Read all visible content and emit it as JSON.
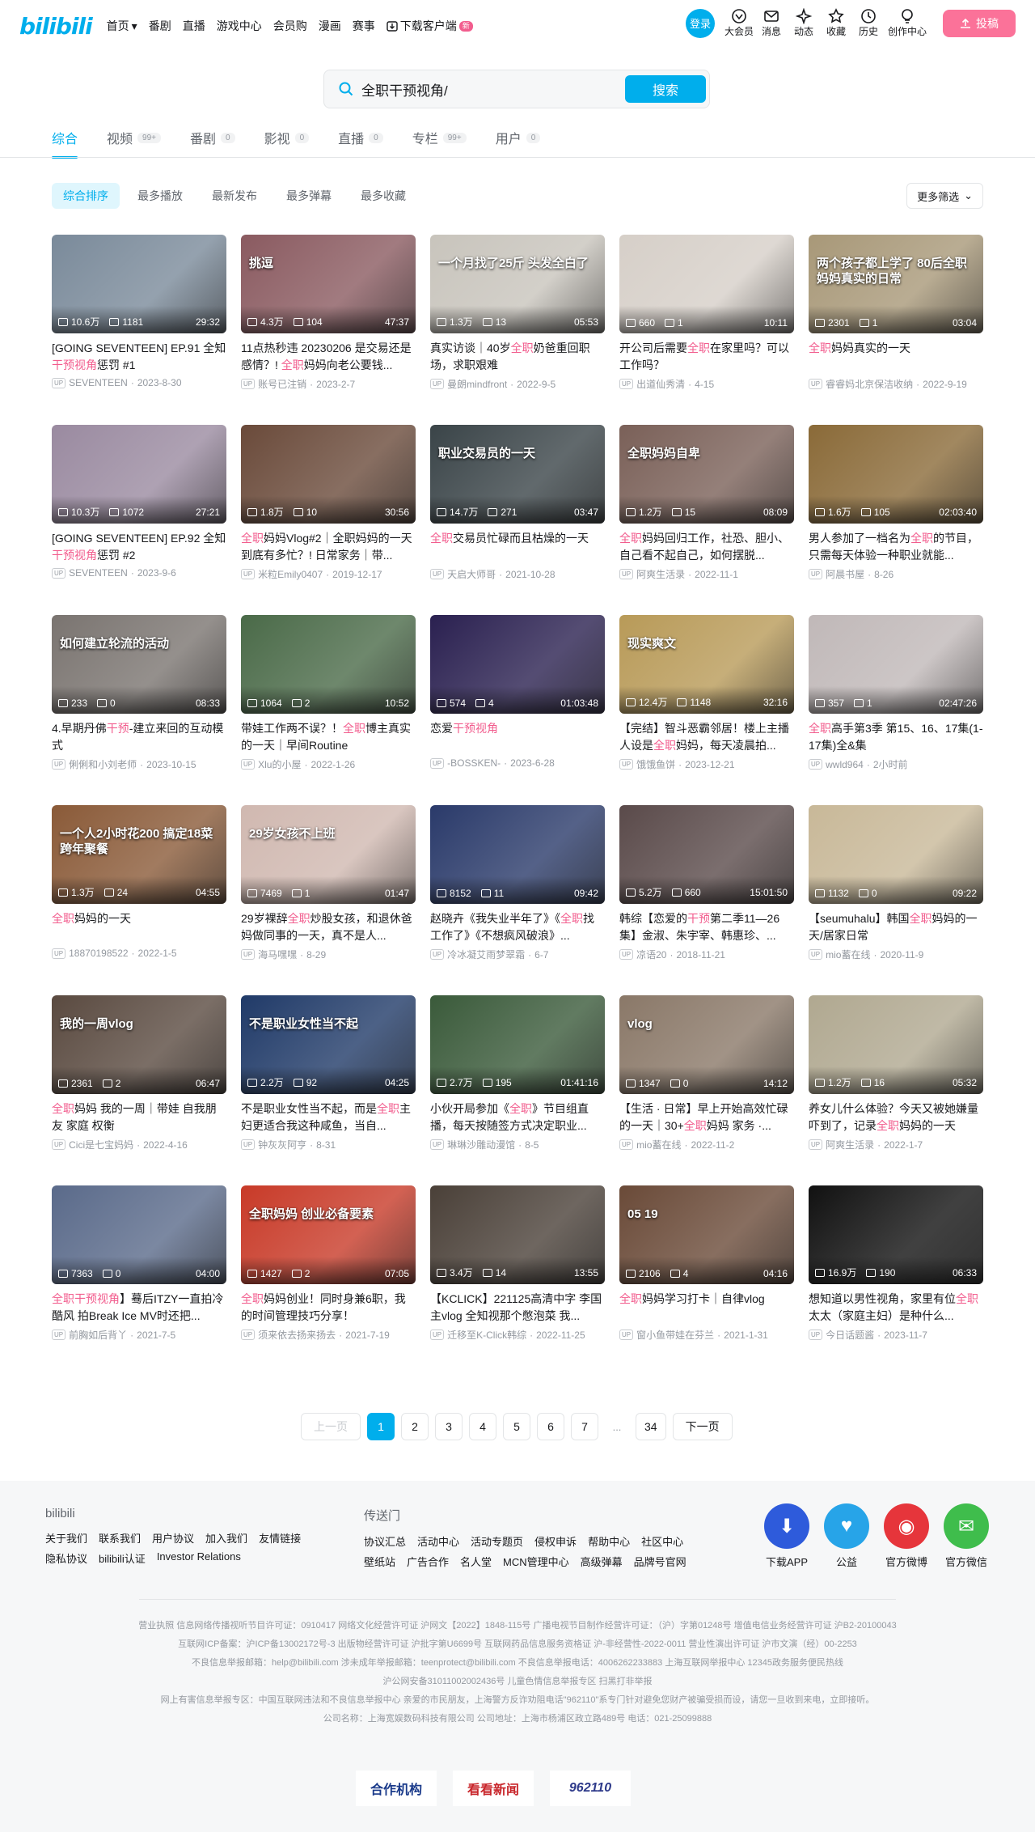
{
  "header": {
    "logo": "bilibili",
    "nav": [
      "首页",
      "番剧",
      "直播",
      "游戏中心",
      "会员购",
      "漫画",
      "赛事",
      "下载客户端"
    ],
    "download_badge": "新",
    "login": "登录",
    "icons": [
      {
        "label": "大会员",
        "icon": "vip-icon"
      },
      {
        "label": "消息",
        "icon": "message-icon"
      },
      {
        "label": "动态",
        "icon": "dynamic-icon"
      },
      {
        "label": "收藏",
        "icon": "star-icon"
      },
      {
        "label": "历史",
        "icon": "history-icon"
      },
      {
        "label": "创作中心",
        "icon": "bulb-icon"
      }
    ],
    "upload": "投稿"
  },
  "search": {
    "value": "全职干预视角/",
    "button": "搜索"
  },
  "tabs": [
    {
      "label": "综合",
      "count": ""
    },
    {
      "label": "视频",
      "count": "99+"
    },
    {
      "label": "番剧",
      "count": "0"
    },
    {
      "label": "影视",
      "count": "0"
    },
    {
      "label": "直播",
      "count": "0"
    },
    {
      "label": "专栏",
      "count": "99+"
    },
    {
      "label": "用户",
      "count": "0"
    }
  ],
  "sorts": [
    "综合排序",
    "最多播放",
    "最新发布",
    "最多弹幕",
    "最多收藏"
  ],
  "filter": "更多筛选",
  "videos": [
    {
      "title": "[GOING SEVENTEEN] EP.91 全知干预视角惩罚 #1",
      "hl": "干预视角",
      "plays": "10.6万",
      "danmaku": "1181",
      "duration": "29:32",
      "author": "SEVENTEEN",
      "date": "2023-8-30",
      "overlay": "",
      "bg": "#7a8a9a"
    },
    {
      "title": "11点热秒违 20230206 是交易还是感情？! 全职妈妈向老公要钱...",
      "hl": "全职",
      "plays": "4.3万",
      "danmaku": "104",
      "duration": "47:37",
      "author": "账号已注销",
      "date": "2023-2-7",
      "overlay": "挑逗",
      "bg": "#8a5a60"
    },
    {
      "title": "真实访谈｜40岁全职奶爸重回职场，求职艰难",
      "hl": "全职",
      "plays": "1.3万",
      "danmaku": "13",
      "duration": "05:53",
      "author": "曼朗mindfront",
      "date": "2022-9-5",
      "overlay": "一个月找了25斤 头发全白了",
      "bg": "#c8c4bc"
    },
    {
      "title": "开公司后需要全职在家里吗？可以工作吗？",
      "hl": "全职",
      "plays": "660",
      "danmaku": "1",
      "duration": "10:11",
      "author": "出道仙秀清",
      "date": "4-15",
      "overlay": "",
      "bg": "#d6cfc8"
    },
    {
      "title": "全职妈妈真实的一天",
      "hl": "全职",
      "plays": "2301",
      "danmaku": "1",
      "duration": "03:04",
      "author": "睿睿妈北京保洁收纳",
      "date": "2022-9-19",
      "overlay": "两个孩子都上学了 80后全职妈妈真实的日常",
      "bg": "#a89878"
    },
    {
      "title": "[GOING SEVENTEEN] EP.92 全知干预视角惩罚 #2",
      "hl": "干预视角",
      "plays": "10.3万",
      "danmaku": "1072",
      "duration": "27:21",
      "author": "SEVENTEEN",
      "date": "2023-9-6",
      "overlay": "",
      "bg": "#9a8aa0"
    },
    {
      "title": "全职妈妈Vlog#2｜全职妈妈的一天到底有多忙？! 日常家务｜带...",
      "hl": "全职",
      "plays": "1.8万",
      "danmaku": "10",
      "duration": "30:56",
      "author": "米粒Emily0407",
      "date": "2019-12-17",
      "overlay": "",
      "bg": "#6a4a3a"
    },
    {
      "title": "全职交易员忙碌而且枯燥的一天",
      "hl": "全职",
      "plays": "14.7万",
      "danmaku": "271",
      "duration": "03:47",
      "author": "天启大师哥",
      "date": "2021-10-28",
      "overlay": "职业交易员的一天",
      "bg": "#3a4448"
    },
    {
      "title": "全职妈妈回归工作，社恐、胆小、自己看不起自己，如何摆脱...",
      "hl": "全职",
      "plays": "1.2万",
      "danmaku": "15",
      "duration": "08:09",
      "author": "阿爽生活录",
      "date": "2022-11-1",
      "overlay": "全职妈妈自卑",
      "bg": "#7a6058"
    },
    {
      "title": "男人参加了一档名为全职的节目，只需每天体验一种职业就能...",
      "hl": "全职",
      "plays": "1.6万",
      "danmaku": "105",
      "duration": "02:03:40",
      "author": "阿晨书屋",
      "date": "8-26",
      "overlay": "",
      "bg": "#8a6a38"
    },
    {
      "title": "4.早期丹佛干预-建立来回的互动模式",
      "hl": "干预",
      "plays": "233",
      "danmaku": "0",
      "duration": "08:33",
      "author": "俐俐和小刘老师",
      "date": "2023-10-15",
      "overlay": "如何建立轮流的活动",
      "bg": "#7a7470"
    },
    {
      "title": "带娃工作两不误？！全职博主真实的一天｜早间Routine",
      "hl": "全职",
      "plays": "1064",
      "danmaku": "2",
      "duration": "10:52",
      "author": "Xlu的小屋",
      "date": "2022-1-26",
      "overlay": "",
      "bg": "#4a6a48"
    },
    {
      "title": "恋爱干预视角",
      "hl": "干预视角",
      "plays": "574",
      "danmaku": "4",
      "duration": "01:03:48",
      "author": "-BOSSKEN-",
      "date": "2023-6-28",
      "overlay": "",
      "bg": "#2a2050"
    },
    {
      "title": "【完结】智斗恶霸邻居！楼上主播人设是全职妈妈，每天凌晨拍...",
      "hl": "全职",
      "plays": "12.4万",
      "danmaku": "1148",
      "duration": "32:16",
      "author": "饿饿鱼饼",
      "date": "2023-12-21",
      "overlay": "现实爽文",
      "bg": "#b89a58"
    },
    {
      "title": "全职高手第3季 第15、16、17集(1-17集)全&集",
      "hl": "全职",
      "plays": "357",
      "danmaku": "1",
      "duration": "02:47:26",
      "author": "wwld964",
      "date": "2小时前",
      "overlay": "",
      "bg": "#c0b8b8"
    },
    {
      "title": "全职妈妈的一天",
      "hl": "全职",
      "plays": "1.3万",
      "danmaku": "24",
      "duration": "04:55",
      "author": "18870198522",
      "date": "2022-1-5",
      "overlay": "一个人2小时花200 搞定18菜跨年聚餐",
      "bg": "#8a5a38"
    },
    {
      "title": "29岁裸辞全职炒股女孩，和退休爸妈做同事的一天，真不是人...",
      "hl": "全职",
      "plays": "7469",
      "danmaku": "1",
      "duration": "01:47",
      "author": "海马嘿嘿",
      "date": "8-29",
      "overlay": "29岁女孩不上班",
      "bg": "#d0b8b0"
    },
    {
      "title": "赵晓卉《我失业半年了》《全职找工作了》《不想疯风破浪》...",
      "hl": "全职",
      "plays": "8152",
      "danmaku": "11",
      "duration": "09:42",
      "author": "冷冰凝艾雨梦翠霜",
      "date": "6-7",
      "overlay": "",
      "bg": "#2a3a6a"
    },
    {
      "title": "韩综【恋爱的干预第二季11—26集】金淑、朱宇宰、韩惠珍、...",
      "hl": "干预",
      "plays": "5.2万",
      "danmaku": "660",
      "duration": "15:01:50",
      "author": "凉语20",
      "date": "2018-11-21",
      "overlay": "",
      "bg": "#5a4a4a"
    },
    {
      "title": "【seumuhalu】韩国全职妈妈的一天/居家日常",
      "hl": "全职",
      "plays": "1132",
      "danmaku": "0",
      "duration": "09:22",
      "author": "mio蓄在线",
      "date": "2020-11-9",
      "overlay": "",
      "bg": "#c8b898"
    },
    {
      "title": "全职妈妈 我的一周｜带娃 自我朋友 家庭 权衡",
      "hl": "全职",
      "plays": "2361",
      "danmaku": "2",
      "duration": "06:47",
      "author": "Cici是七宝妈妈",
      "date": "2022-4-16",
      "overlay": "我的一周vlog",
      "bg": "#5a4a40"
    },
    {
      "title": "不是职业女性当不起，而是全职主妇更适合我这种咸鱼，当自...",
      "hl": "全职",
      "plays": "2.2万",
      "danmaku": "92",
      "duration": "04:25",
      "author": "钟灰灰阿亨",
      "date": "8-31",
      "overlay": "不是职业女性当不起",
      "bg": "#203a68"
    },
    {
      "title": "小伙开局参加《全职》节目组直播，每天按随签方式决定职业...",
      "hl": "全职",
      "plays": "2.7万",
      "danmaku": "195",
      "duration": "01:41:16",
      "author": "琳琳沙雕动漫馆",
      "date": "8-5",
      "overlay": "",
      "bg": "#3a5a3a"
    },
    {
      "title": "【生活 · 日常】早上开始高效忙碌的一天｜30+全职妈妈 家务 ·...",
      "hl": "全职",
      "plays": "1347",
      "danmaku": "0",
      "duration": "14:12",
      "author": "mio蓄在线",
      "date": "2022-11-2",
      "overlay": "vlog",
      "bg": "#8a7868"
    },
    {
      "title": "养女儿什么体验？今天又被她嫌量吓到了，记录全职妈妈的一天",
      "hl": "全职",
      "plays": "1.2万",
      "danmaku": "16",
      "duration": "05:32",
      "author": "阿爽生活录",
      "date": "2022-1-7",
      "overlay": "",
      "bg": "#b0a890"
    },
    {
      "title": "全职干预视角】蓦后ITZY一直拍冷酷风 拍Break Ice MV时还把...",
      "hl": "全职干预视角",
      "plays": "7363",
      "danmaku": "0",
      "duration": "04:00",
      "author": "前胸如后背丫",
      "date": "2021-7-5",
      "overlay": "",
      "bg": "#5a6a8a"
    },
    {
      "title": "全职妈妈创业！同时身兼6职，我的时间管理技巧分享！",
      "hl": "全职",
      "plays": "1427",
      "danmaku": "2",
      "duration": "07:05",
      "author": "须来依去扬来扬去",
      "date": "2021-7-19",
      "overlay": "全职妈妈 创业必备要素",
      "bg": "#c83a28"
    },
    {
      "title": "【KCLICK】221125高清中字 李国主vlog 全知视那个憋泡菜 我...",
      "hl": "",
      "plays": "3.4万",
      "danmaku": "14",
      "duration": "13:55",
      "author": "迁移至K-Click韩综",
      "date": "2022-11-25",
      "overlay": "",
      "bg": "#4a4038"
    },
    {
      "title": "全职妈妈学习打卡｜自律vlog",
      "hl": "全职",
      "plays": "2106",
      "danmaku": "4",
      "duration": "04:16",
      "author": "窗小鱼带娃在芬兰",
      "date": "2021-1-31",
      "overlay": "05 19",
      "bg": "#6a4a38"
    },
    {
      "title": "想知道以男性视角，家里有位全职太太（家庭主妇）是种什么...",
      "hl": "全职",
      "plays": "16.9万",
      "danmaku": "190",
      "duration": "06:33",
      "author": "今日话题酱",
      "date": "2023-11-7",
      "overlay": "",
      "bg": "#111111"
    }
  ],
  "pager": {
    "prev": "上一页",
    "pages": [
      "1",
      "2",
      "3",
      "4",
      "5",
      "6",
      "7"
    ],
    "dots": "...",
    "last": "34",
    "next": "下一页"
  },
  "footer": {
    "col1": {
      "title": "bilibili",
      "links": [
        "关于我们",
        "联系我们",
        "用户协议",
        "加入我们",
        "友情链接",
        "隐私协议",
        "bilibili认证",
        "Investor Relations"
      ]
    },
    "col2": {
      "title": "传送门",
      "links": [
        "协议汇总",
        "活动中心",
        "活动专题页",
        "侵权申诉",
        "帮助中心",
        "社区中心",
        "壁纸站",
        "广告合作",
        "名人堂",
        "MCN管理中心",
        "高级弹幕",
        "品牌号官网"
      ]
    },
    "apps": [
      {
        "label": "下载APP",
        "color": "#2e5bdb",
        "icon": "download-icon"
      },
      {
        "label": "公益",
        "color": "#27a4e8",
        "icon": "charity-icon"
      },
      {
        "label": "官方微博",
        "color": "#e6353b",
        "icon": "weibo-icon"
      },
      {
        "label": "官方微信",
        "color": "#3fbd4c",
        "icon": "wechat-icon"
      }
    ],
    "legal": [
      "营业执照  信息网络传播视听节目许可证：0910417  网络文化经营许可证 沪网文【2022】1848-115号  广播电视节目制作经营许可证：（沪）字第01248号  增值电信业务经营许可证 沪B2-20100043",
      "互联网ICP备案：沪ICP备13002172号-3  出版物经营许可证 沪批字第U6699号  互联网药品信息服务资格证 沪-非经营性-2022-0011  营业性演出许可证 沪市文演（经）00-2253",
      "不良信息举报邮箱：help@bilibili.com  涉未成年举报邮箱：teenprotect@bilibili.com  不良信息举报电话：4006262233883  上海互联网举报中心  12345政务服务便民热线",
      "沪公网安备31011002002436号  儿童色情信息举报专区  扫黑打非举报",
      "网上有害信息举报专区：中国互联网违法和不良信息举报中心  亲爱的市民朋友，上海警方反诈劝阻电话\"962110\"系专门针对避免您财产被骗受损而设，请您一旦收到来电，立即接听。",
      "公司名称：上海宽娱数码科技有限公司  公司地址：上海市杨浦区政立路489号  电话：021-25099888"
    ],
    "partners": [
      "合作机构",
      "看看新闻",
      "962110"
    ]
  }
}
